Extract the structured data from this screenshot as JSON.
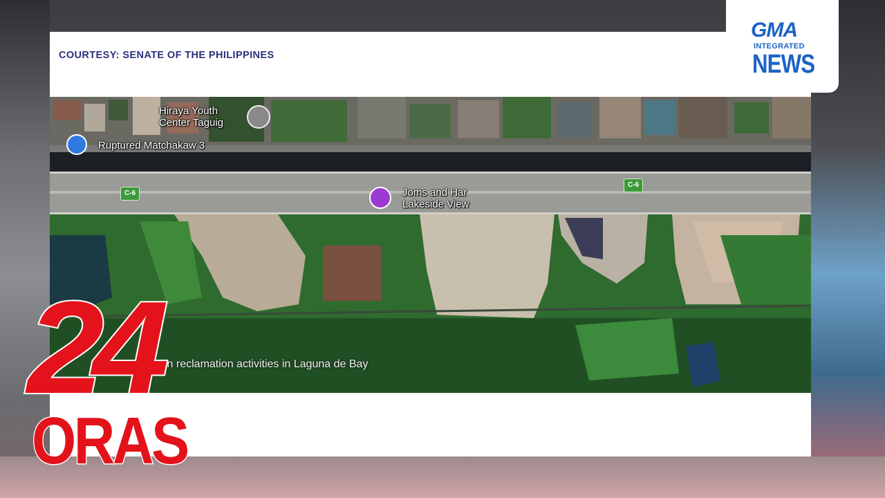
{
  "panel": {
    "courtesy": "COURTESY: SENATE OF THE PHILIPPINES"
  },
  "map": {
    "labels": {
      "youth_center": "Hiraya Youth\nCenter Taguig",
      "ruptured": "Ruptured Matchakaw 3",
      "lakeside": "Joms and Har\nLakeside View",
      "road_left": "C-6",
      "road_right": "C-6"
    },
    "caption": "in reclamation activities in Laguna de Bay"
  },
  "network_logo": {
    "brand": "GMA",
    "sub": "INTEGRATED",
    "news": "NEWS"
  },
  "show_logo": {
    "number": "24",
    "word": "ORAS"
  },
  "colors": {
    "courtesy_text": "#2b2f7a",
    "gma_blue": "#1b63c6",
    "oras_red": "#e4121b",
    "road_sign_green": "#3b9a3b"
  }
}
